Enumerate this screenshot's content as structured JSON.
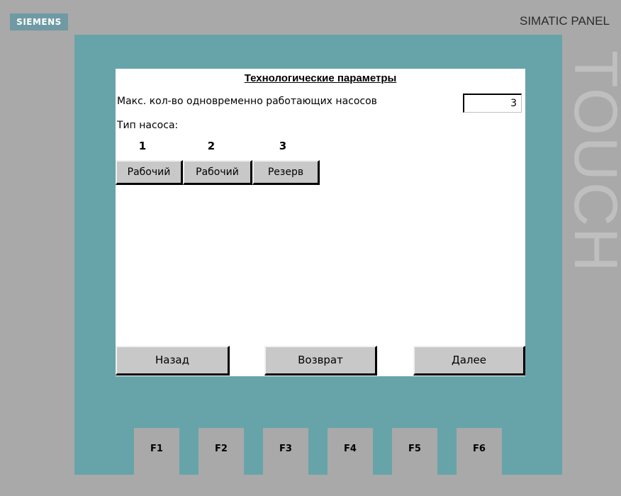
{
  "device": {
    "brand": "SIEMENS",
    "model": "SIMATIC PANEL",
    "touch_label": "TOUCH",
    "colors": {
      "housing": "#a9a9a9",
      "bezel": "#67a4a9",
      "screen": "#ffffff",
      "button": "#c8c8c8"
    }
  },
  "screen": {
    "title": "Технологические параметры",
    "max_pumps_label": "Макс. кол-во одновременно работающих насосов",
    "max_pumps_value": "3",
    "pump_type_label": "Тип насоса:",
    "pumps": [
      {
        "number": "1",
        "mode": "Рабочий"
      },
      {
        "number": "2",
        "mode": "Рабочий"
      },
      {
        "number": "3",
        "mode": "Резерв"
      }
    ],
    "nav": {
      "back": "Назад",
      "return": "Возврат",
      "next": "Далее"
    }
  },
  "function_keys": [
    "F1",
    "F2",
    "F3",
    "F4",
    "F5",
    "F6"
  ]
}
